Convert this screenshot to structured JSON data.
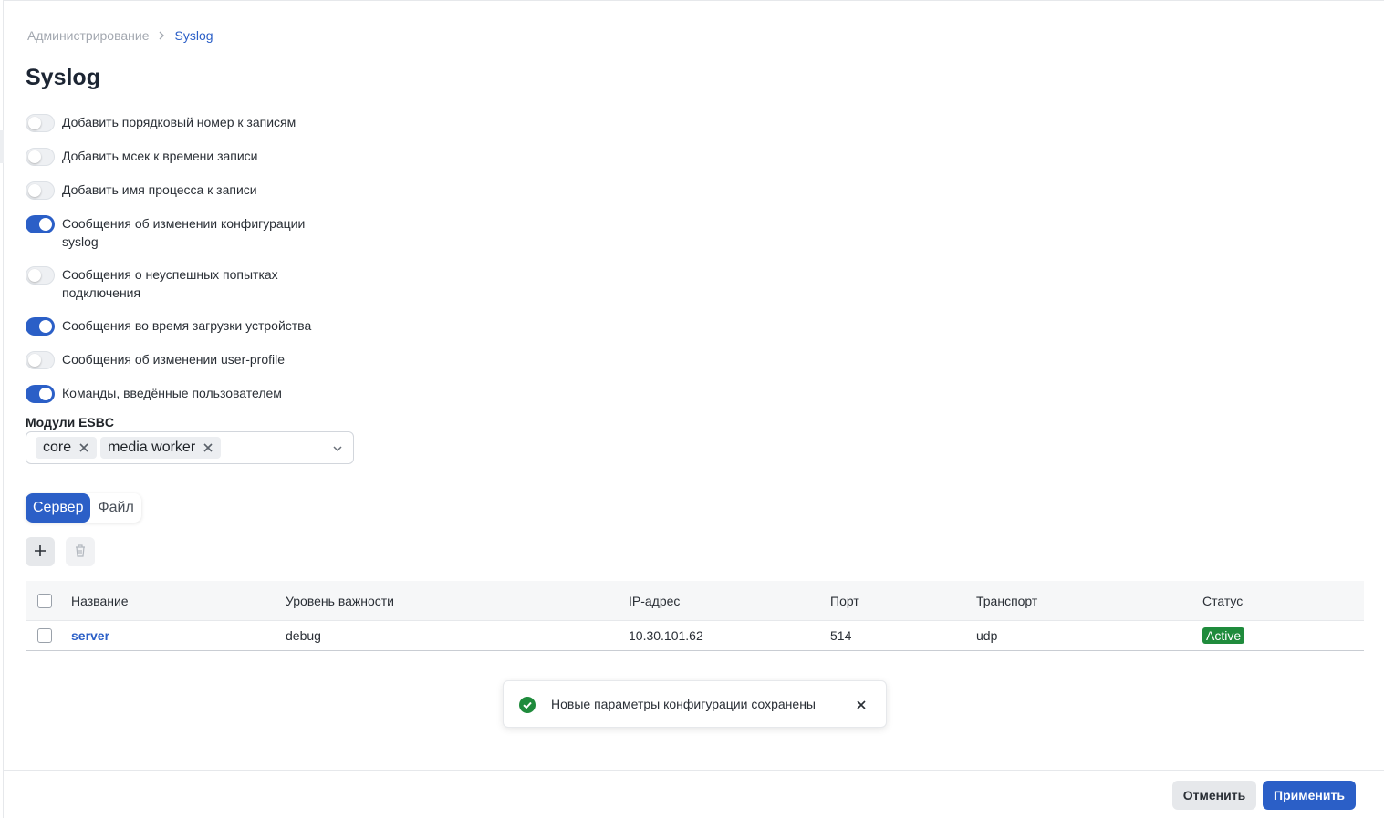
{
  "breadcrumb": {
    "root": "Администрирование",
    "current": "Syslog"
  },
  "page": {
    "title": "Syslog"
  },
  "toggles": [
    {
      "label": "Добавить порядковый номер к записям",
      "on": false
    },
    {
      "label": "Добавить мсек к времени записи",
      "on": false
    },
    {
      "label": "Добавить имя процесса к записи",
      "on": false
    },
    {
      "label": "Сообщения об изменении конфигурации syslog",
      "on": true
    },
    {
      "label": "Сообщения о неуспешных попытках подключения",
      "on": false
    },
    {
      "label": "Сообщения во время загрузки устройства",
      "on": true
    },
    {
      "label": "Сообщения об изменении user-profile",
      "on": false
    },
    {
      "label": "Команды, введённые пользователем",
      "on": true
    }
  ],
  "modules": {
    "label": "Модули ESBC",
    "chips": [
      "core",
      "media worker"
    ]
  },
  "segment": {
    "server": "Сервер",
    "file": "Файл",
    "active": "server"
  },
  "table": {
    "headers": {
      "name": "Название",
      "severity": "Уровень важности",
      "ip": "IP-адрес",
      "port": "Порт",
      "transport": "Транспорт",
      "status": "Статус"
    },
    "rows": [
      {
        "name": "server",
        "severity": "debug",
        "ip": "10.30.101.62",
        "port": "514",
        "transport": "udp",
        "status": "Active"
      }
    ]
  },
  "toast": {
    "message": "Новые параметры конфигурации сохранены"
  },
  "footer": {
    "cancel": "Отменить",
    "apply": "Применить"
  },
  "colors": {
    "accent": "#2b5fc7",
    "success": "#1f8b3c"
  }
}
